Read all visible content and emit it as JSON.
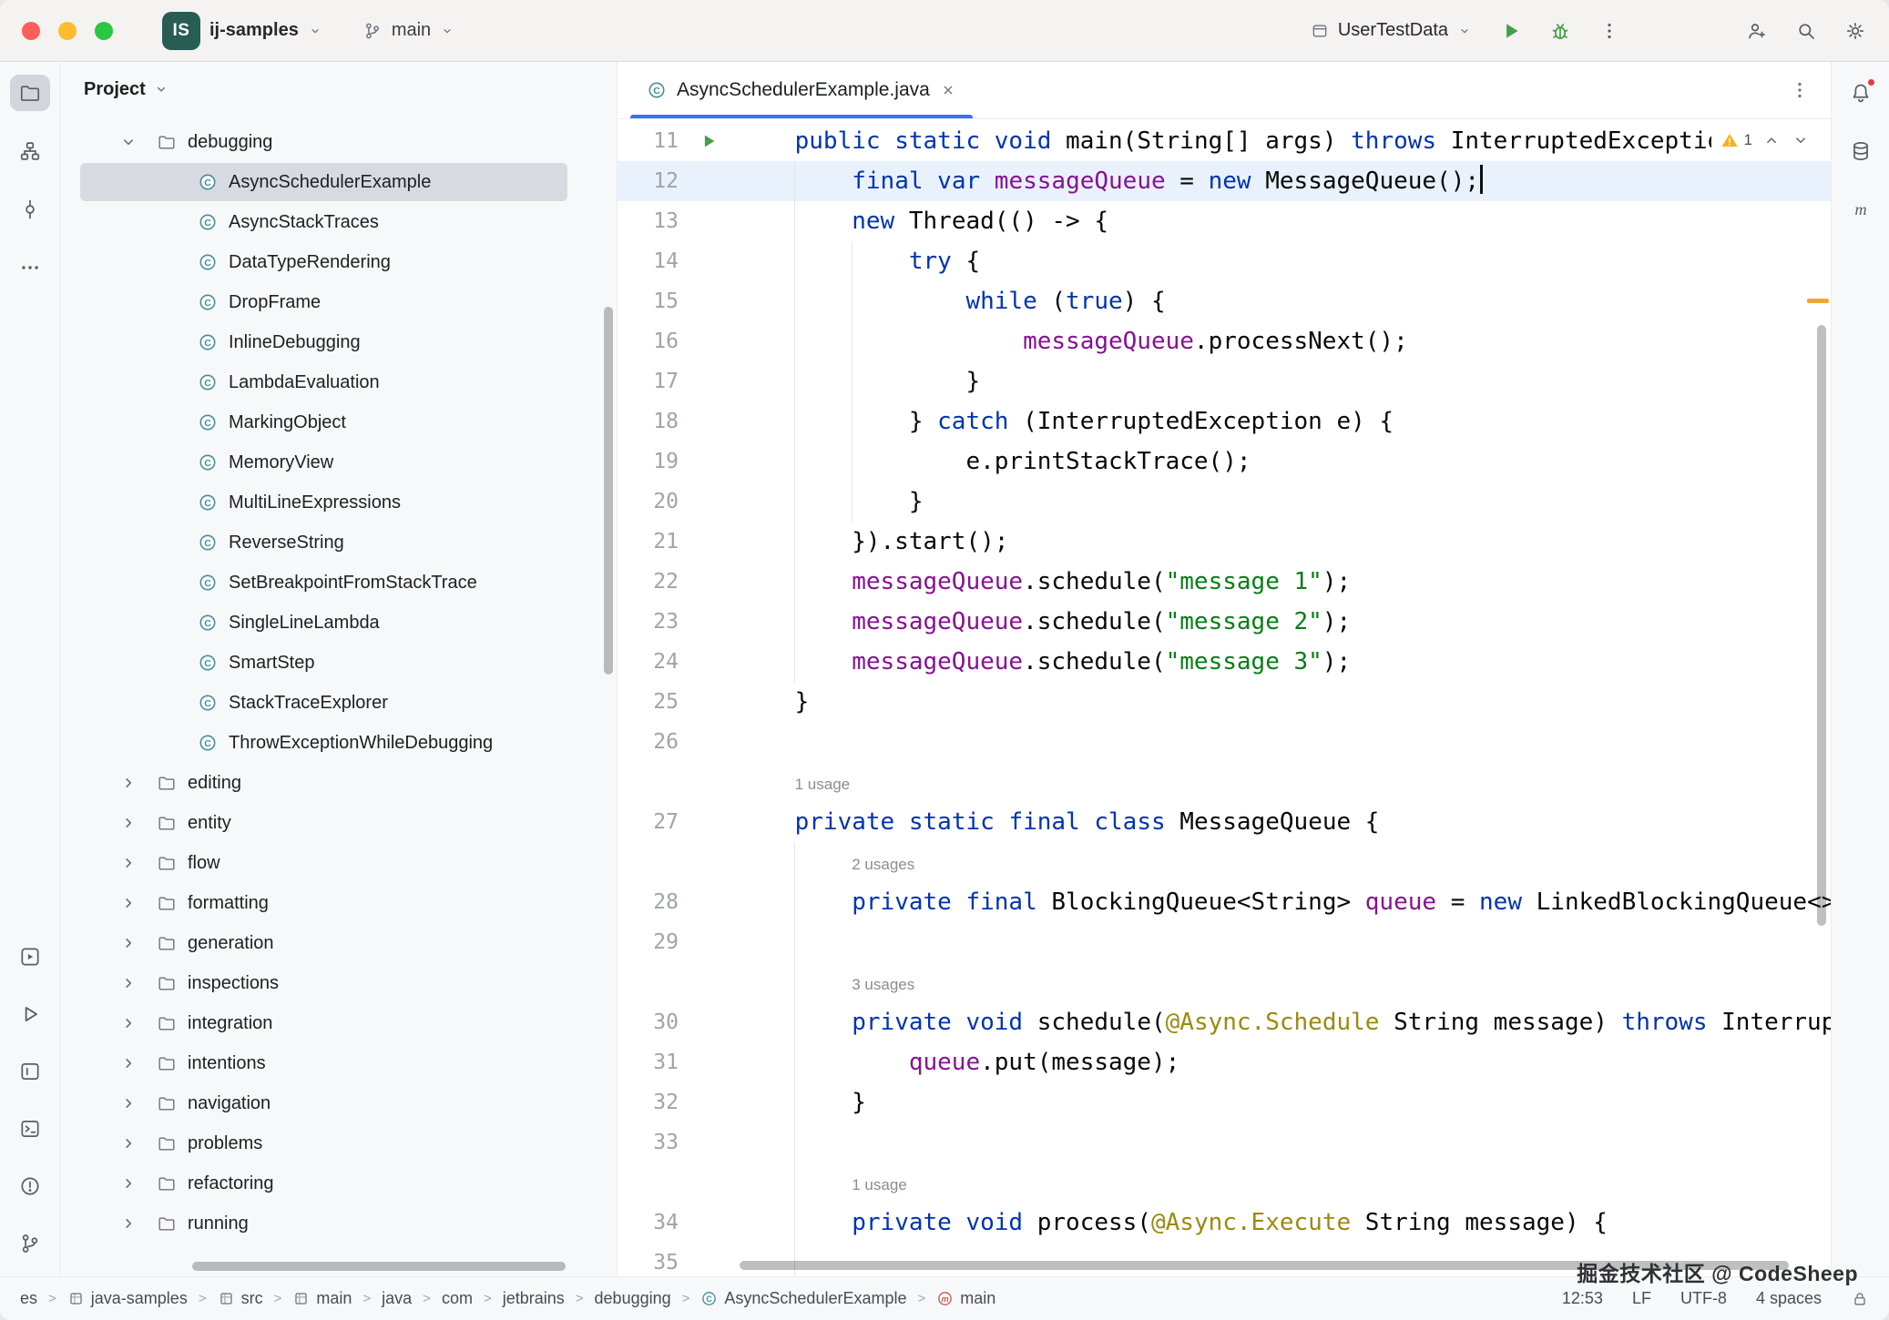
{
  "title_bar": {
    "window_controls": [
      "#FF5F57",
      "#FEBC2E",
      "#28C840"
    ],
    "project_badge": "IS",
    "project_name": "ij-samples",
    "branch": "main",
    "run_config": "UserTestData"
  },
  "left_toolbar": {
    "top": [
      {
        "name": "project",
        "icon": "folder",
        "active": true
      },
      {
        "name": "structure",
        "icon": "structure"
      },
      {
        "name": "commit",
        "icon": "commit"
      },
      {
        "name": "more-tool-windows",
        "icon": "more-h"
      }
    ],
    "bottom": [
      {
        "name": "services",
        "icon": "services"
      },
      {
        "name": "run-tool",
        "icon": "run-outline"
      },
      {
        "name": "console",
        "icon": "console"
      },
      {
        "name": "terminal",
        "icon": "terminal"
      },
      {
        "name": "problems",
        "icon": "problems"
      },
      {
        "name": "version-control",
        "icon": "vcs"
      }
    ]
  },
  "right_toolbar": [
    {
      "name": "notifications",
      "icon": "bell",
      "badge": true
    },
    {
      "name": "database",
      "icon": "database"
    },
    {
      "name": "maven",
      "icon": "maven"
    }
  ],
  "project_panel": {
    "title": "Project",
    "tree": [
      {
        "label": "debugging",
        "type": "folder",
        "level": 0,
        "expanded": true
      },
      {
        "label": "AsyncSchedulerExample",
        "type": "class",
        "level": 1,
        "selected": true
      },
      {
        "label": "AsyncStackTraces",
        "type": "class",
        "level": 1
      },
      {
        "label": "DataTypeRendering",
        "type": "class",
        "level": 1
      },
      {
        "label": "DropFrame",
        "type": "class",
        "level": 1
      },
      {
        "label": "InlineDebugging",
        "type": "class",
        "level": 1
      },
      {
        "label": "LambdaEvaluation",
        "type": "class",
        "level": 1
      },
      {
        "label": "MarkingObject",
        "type": "class",
        "level": 1
      },
      {
        "label": "MemoryView",
        "type": "class",
        "level": 1
      },
      {
        "label": "MultiLineExpressions",
        "type": "class",
        "level": 1
      },
      {
        "label": "ReverseString",
        "type": "class",
        "level": 1
      },
      {
        "label": "SetBreakpointFromStackTrace",
        "type": "class",
        "level": 1
      },
      {
        "label": "SingleLineLambda",
        "type": "class",
        "level": 1
      },
      {
        "label": "SmartStep",
        "type": "class",
        "level": 1
      },
      {
        "label": "StackTraceExplorer",
        "type": "class",
        "level": 1
      },
      {
        "label": "ThrowExceptionWhileDebugging",
        "type": "class",
        "level": 1
      },
      {
        "label": "editing",
        "type": "folder",
        "level": 0
      },
      {
        "label": "entity",
        "type": "folder",
        "level": 0
      },
      {
        "label": "flow",
        "type": "folder",
        "level": 0
      },
      {
        "label": "formatting",
        "type": "folder",
        "level": 0
      },
      {
        "label": "generation",
        "type": "folder",
        "level": 0
      },
      {
        "label": "inspections",
        "type": "folder",
        "level": 0
      },
      {
        "label": "integration",
        "type": "folder",
        "level": 0
      },
      {
        "label": "intentions",
        "type": "folder",
        "level": 0
      },
      {
        "label": "navigation",
        "type": "folder",
        "level": 0
      },
      {
        "label": "problems",
        "type": "folder",
        "level": 0
      },
      {
        "label": "refactoring",
        "type": "folder",
        "level": 0
      },
      {
        "label": "running",
        "type": "folder",
        "level": 0
      }
    ]
  },
  "editor": {
    "tab": {
      "title": "AsyncSchedulerExample.java"
    },
    "inspections": {
      "warning_count": "1"
    },
    "code": [
      {
        "n": "11",
        "icon": "run",
        "t": [
          [
            "p",
            "    "
          ],
          [
            "k",
            "public"
          ],
          [
            "p",
            " "
          ],
          [
            "k",
            "static"
          ],
          [
            "p",
            " "
          ],
          [
            "k",
            "void"
          ],
          [
            "p",
            " main(String[] args) "
          ],
          [
            "k",
            "throws"
          ],
          [
            "p",
            " InterruptedException {"
          ]
        ]
      },
      {
        "n": "12",
        "hl": true,
        "t": [
          [
            "p",
            "        "
          ],
          [
            "k",
            "final"
          ],
          [
            "p",
            " "
          ],
          [
            "k",
            "var"
          ],
          [
            "p",
            " "
          ],
          [
            "f",
            "messageQueue"
          ],
          [
            "p",
            " = "
          ],
          [
            "k",
            "new"
          ],
          [
            "p",
            " MessageQueue();"
          ],
          [
            "c",
            ""
          ]
        ]
      },
      {
        "n": "13",
        "t": [
          [
            "p",
            "        "
          ],
          [
            "k",
            "new"
          ],
          [
            "p",
            " Thread(() -> {"
          ]
        ]
      },
      {
        "n": "14",
        "t": [
          [
            "p",
            "            "
          ],
          [
            "k",
            "try"
          ],
          [
            "p",
            " {"
          ]
        ]
      },
      {
        "n": "15",
        "t": [
          [
            "p",
            "                "
          ],
          [
            "k",
            "while"
          ],
          [
            "p",
            " ("
          ],
          [
            "k",
            "true"
          ],
          [
            "p",
            ") {"
          ]
        ]
      },
      {
        "n": "16",
        "t": [
          [
            "p",
            "                    "
          ],
          [
            "f",
            "messageQueue"
          ],
          [
            "p",
            ".processNext();"
          ]
        ]
      },
      {
        "n": "17",
        "t": [
          [
            "p",
            "                }"
          ]
        ]
      },
      {
        "n": "18",
        "t": [
          [
            "p",
            "            } "
          ],
          [
            "k",
            "catch"
          ],
          [
            "p",
            " (InterruptedException e) {"
          ]
        ]
      },
      {
        "n": "19",
        "t": [
          [
            "p",
            "                e.printStackTrace();"
          ]
        ]
      },
      {
        "n": "20",
        "t": [
          [
            "p",
            "            }"
          ]
        ]
      },
      {
        "n": "21",
        "t": [
          [
            "p",
            "        }).start();"
          ]
        ]
      },
      {
        "n": "22",
        "t": [
          [
            "p",
            "        "
          ],
          [
            "f",
            "messageQueue"
          ],
          [
            "p",
            ".schedule("
          ],
          [
            "s",
            "\"message 1\""
          ],
          [
            "p",
            ");"
          ]
        ]
      },
      {
        "n": "23",
        "t": [
          [
            "p",
            "        "
          ],
          [
            "f",
            "messageQueue"
          ],
          [
            "p",
            ".schedule("
          ],
          [
            "s",
            "\"message 2\""
          ],
          [
            "p",
            ");"
          ]
        ]
      },
      {
        "n": "24",
        "t": [
          [
            "p",
            "        "
          ],
          [
            "f",
            "messageQueue"
          ],
          [
            "p",
            ".schedule("
          ],
          [
            "s",
            "\"message 3\""
          ],
          [
            "p",
            ");"
          ]
        ]
      },
      {
        "n": "25",
        "t": [
          [
            "p",
            "    }"
          ]
        ]
      },
      {
        "n": "26",
        "t": []
      },
      {
        "inlay": true,
        "t": [
          [
            "p",
            "    "
          ],
          [
            "u",
            "1 usage"
          ]
        ]
      },
      {
        "n": "27",
        "t": [
          [
            "p",
            "    "
          ],
          [
            "k",
            "private"
          ],
          [
            "p",
            " "
          ],
          [
            "k",
            "static"
          ],
          [
            "p",
            " "
          ],
          [
            "k",
            "final"
          ],
          [
            "p",
            " "
          ],
          [
            "k",
            "class"
          ],
          [
            "p",
            " MessageQueue {"
          ]
        ]
      },
      {
        "inlay": true,
        "t": [
          [
            "p",
            "        "
          ],
          [
            "u",
            "2 usages"
          ]
        ]
      },
      {
        "n": "28",
        "t": [
          [
            "p",
            "        "
          ],
          [
            "k",
            "private"
          ],
          [
            "p",
            " "
          ],
          [
            "k",
            "final"
          ],
          [
            "p",
            " BlockingQueue<String> "
          ],
          [
            "f",
            "queue"
          ],
          [
            "p",
            " = "
          ],
          [
            "k",
            "new"
          ],
          [
            "p",
            " LinkedBlockingQueue<>();"
          ]
        ]
      },
      {
        "n": "29",
        "t": []
      },
      {
        "inlay": true,
        "t": [
          [
            "p",
            "        "
          ],
          [
            "u",
            "3 usages"
          ]
        ]
      },
      {
        "n": "30",
        "t": [
          [
            "p",
            "        "
          ],
          [
            "k",
            "private"
          ],
          [
            "p",
            " "
          ],
          [
            "k",
            "void"
          ],
          [
            "p",
            " schedule("
          ],
          [
            "a",
            "@Async.Schedule"
          ],
          [
            "p",
            " String message) "
          ],
          [
            "k",
            "throws"
          ],
          [
            "p",
            " InterruptedException {"
          ]
        ]
      },
      {
        "n": "31",
        "t": [
          [
            "p",
            "            "
          ],
          [
            "f",
            "queue"
          ],
          [
            "p",
            ".put(message);"
          ]
        ]
      },
      {
        "n": "32",
        "t": [
          [
            "p",
            "        }"
          ]
        ]
      },
      {
        "n": "33",
        "t": []
      },
      {
        "inlay": true,
        "t": [
          [
            "p",
            "        "
          ],
          [
            "u",
            "1 usage"
          ]
        ]
      },
      {
        "n": "34",
        "t": [
          [
            "p",
            "        "
          ],
          [
            "k",
            "private"
          ],
          [
            "p",
            " "
          ],
          [
            "k",
            "void"
          ],
          [
            "p",
            " process("
          ],
          [
            "a",
            "@Async.Execute"
          ],
          [
            "p",
            " String message) {"
          ]
        ]
      },
      {
        "n": "35",
        "t": []
      }
    ]
  },
  "status_bar": {
    "separator": ">",
    "breadcrumbs": [
      {
        "label": "es"
      },
      {
        "label": "java-samples",
        "icon": "module"
      },
      {
        "label": "src",
        "icon": "module"
      },
      {
        "label": "main",
        "icon": "module"
      },
      {
        "label": "java"
      },
      {
        "label": "com"
      },
      {
        "label": "jetbrains"
      },
      {
        "label": "debugging"
      },
      {
        "label": "AsyncSchedulerExample",
        "icon": "class"
      },
      {
        "label": "main",
        "icon": "method"
      }
    ],
    "caret_position": "12:53",
    "line_ending": "LF",
    "encoding": "UTF-8",
    "indent": "4 spaces"
  },
  "watermark": "掘金技术社区 @ CodeSheep",
  "colors": {
    "accent": "#3574F0",
    "keyword": "#0033B3",
    "string": "#067D17",
    "field": "#871094",
    "annotation": "#9E880D",
    "code_text": "#080808",
    "usage_hint": "#8C8C8C",
    "caret_line": "#E9F2FC",
    "selection": "#D7DAE0",
    "warning": "#FFAF0F",
    "run_green": "#43A047",
    "error_stripe": "#F0A732",
    "project_badge_bg": "#275D54",
    "border": "#EBECF0",
    "panel_bg": "#F7F8FA",
    "titlebar_bg": "#F4F3F1"
  }
}
